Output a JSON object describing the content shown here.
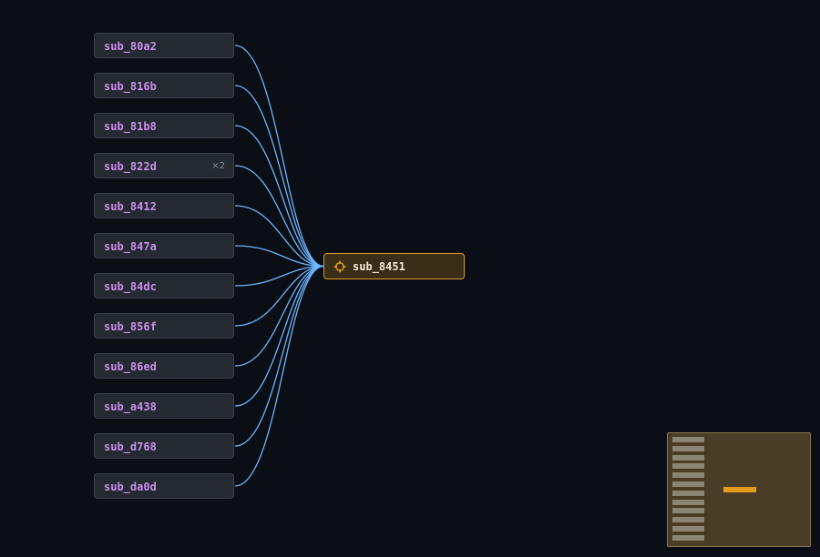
{
  "graph": {
    "target": {
      "label": "sub_8451",
      "icon": "crosshair-icon",
      "accent_color": "#d99a2b"
    },
    "callers": [
      {
        "label": "sub_80a2",
        "count": ""
      },
      {
        "label": "sub_816b",
        "count": ""
      },
      {
        "label": "sub_81b8",
        "count": ""
      },
      {
        "label": "sub_822d",
        "count": "×2"
      },
      {
        "label": "sub_8412",
        "count": ""
      },
      {
        "label": "sub_847a",
        "count": ""
      },
      {
        "label": "sub_84dc",
        "count": ""
      },
      {
        "label": "sub_856f",
        "count": ""
      },
      {
        "label": "sub_86ed",
        "count": ""
      },
      {
        "label": "sub_a438",
        "count": ""
      },
      {
        "label": "sub_d768",
        "count": ""
      },
      {
        "label": "sub_da0d",
        "count": ""
      }
    ],
    "edge_color": "#6cb6ff",
    "caller_label_color": "#c792ea"
  },
  "minimap": {
    "background_color": "#4a3d27",
    "target_color": "#e39c1c"
  }
}
